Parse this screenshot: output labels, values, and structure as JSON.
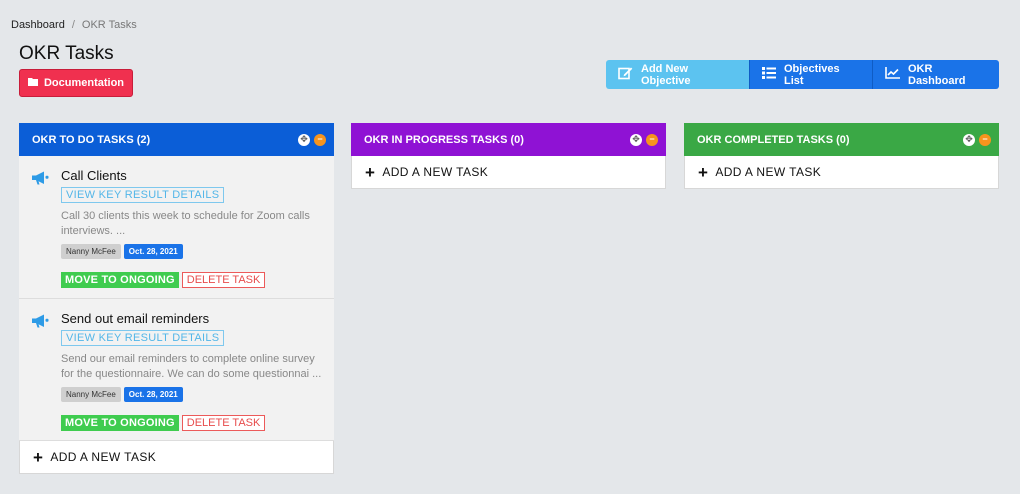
{
  "breadcrumb": {
    "root": "Dashboard",
    "separator": "/",
    "current": "OKR Tasks"
  },
  "page_title": "OKR Tasks",
  "doc_button": "Documentation",
  "header_buttons": {
    "add_objective": "Add New Objective",
    "objectives_list": "Objectives List",
    "okr_dashboard": "OKR Dashboard"
  },
  "colors": {
    "todo": "#0b5ed7",
    "in_progress": "#8f12d4",
    "completed": "#3aa845"
  },
  "columns": [
    {
      "title": "OKR TO DO TASKS (2)",
      "add_label": "ADD A NEW TASK",
      "cards": [
        {
          "title": "Call Clients",
          "kr_label": "VIEW KEY RESULT DETAILS",
          "desc_line1": "Call 30 clients this week to schedule for Zoom calls",
          "desc_line2": "interviews. ...",
          "user": "Nanny McFee",
          "date": "Oct. 28, 2021",
          "move_label": "MOVE TO ONGOING",
          "delete_label": "DELETE TASK"
        },
        {
          "title": "Send out email reminders",
          "kr_label": "VIEW KEY RESULT DETAILS",
          "desc_line1": "Send our email reminders to complete online survey",
          "desc_line2": "for the questionnaire. We can do some questionnai ...",
          "user": "Nanny McFee",
          "date": "Oct. 28, 2021",
          "move_label": "MOVE TO ONGOING",
          "delete_label": "DELETE TASK"
        }
      ]
    },
    {
      "title": "OKR IN PROGRESS TASKS (0)",
      "add_label": "ADD A NEW TASK"
    },
    {
      "title": "OKR COMPLETED TASKS (0)",
      "add_label": "ADD A NEW TASK"
    }
  ]
}
